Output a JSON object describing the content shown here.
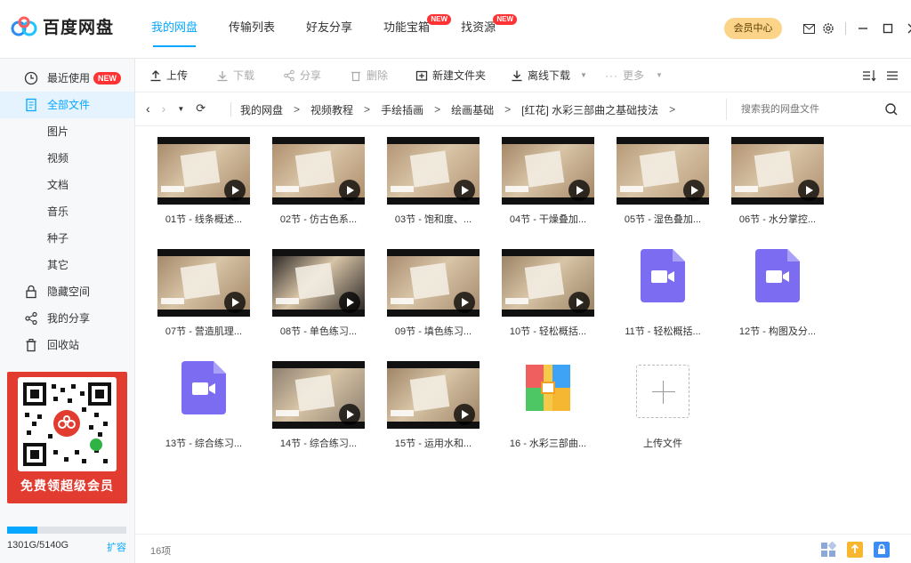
{
  "app": {
    "name": "百度网盘"
  },
  "nav": {
    "tabs": [
      {
        "label": "我的网盘",
        "active": true,
        "badge": ""
      },
      {
        "label": "传输列表",
        "active": false,
        "badge": ""
      },
      {
        "label": "好友分享",
        "active": false,
        "badge": ""
      },
      {
        "label": "功能宝箱",
        "active": false,
        "badge": "NEW"
      },
      {
        "label": "找资源",
        "active": false,
        "badge": "NEW"
      }
    ],
    "vip_label": "会员中心"
  },
  "sidebar": {
    "items": [
      {
        "label": "最近使用",
        "icon": "clock-icon",
        "badge": "NEW"
      },
      {
        "label": "全部文件",
        "icon": "file-icon",
        "active": true
      },
      {
        "label": "图片"
      },
      {
        "label": "视频"
      },
      {
        "label": "文档"
      },
      {
        "label": "音乐"
      },
      {
        "label": "种子"
      },
      {
        "label": "其它"
      },
      {
        "label": "隐藏空间",
        "icon": "lock-icon"
      },
      {
        "label": "我的分享",
        "icon": "share-icon"
      },
      {
        "label": "回收站",
        "icon": "trash-icon"
      }
    ],
    "promo_text": "免费领超级会员",
    "quota": {
      "used_fraction": 0.253,
      "text": "1301G/5140G",
      "expand_label": "扩容"
    }
  },
  "toolbar": {
    "upload": "上传",
    "download": "下载",
    "share": "分享",
    "delete": "删除",
    "new_folder": "新建文件夹",
    "offline_download": "离线下载",
    "more": "更多"
  },
  "breadcrumb": {
    "items": [
      "我的网盘",
      "视频教程",
      "手绘插画",
      "绘画基础",
      "[红花] 水彩三部曲之基础技法"
    ],
    "search_placeholder": "搜索我的网盘文件"
  },
  "files": [
    {
      "name": "01节 - 线条概述...",
      "type": "video-thumb",
      "tone": "#a98c6c"
    },
    {
      "name": "02节 - 仿古色系...",
      "type": "video-thumb",
      "tone": "#b0906e"
    },
    {
      "name": "03节 - 饱和度、...",
      "type": "video-thumb",
      "tone": "#b49676"
    },
    {
      "name": "04节 - 干燥叠加...",
      "type": "video-thumb",
      "tone": "#a58868"
    },
    {
      "name": "05节 - 湿色叠加...",
      "type": "video-thumb",
      "tone": "#b69a78"
    },
    {
      "name": "06节 - 水分掌控...",
      "type": "video-thumb",
      "tone": "#b39474"
    },
    {
      "name": "07节 - 营造肌理...",
      "type": "video-thumb",
      "tone": "#a4896a"
    },
    {
      "name": "08节 - 单色练习...",
      "type": "video-thumb",
      "tone": "#2e2a28"
    },
    {
      "name": "09节 - 填色练习...",
      "type": "video-thumb",
      "tone": "#a88c70"
    },
    {
      "name": "10节 - 轻松概括...",
      "type": "video-thumb",
      "tone": "#9c8466"
    },
    {
      "name": "11节 - 轻松概括...",
      "type": "video-icon"
    },
    {
      "name": "12节 - 构图及分...",
      "type": "video-icon"
    },
    {
      "name": "13节 - 综合练习...",
      "type": "video-icon"
    },
    {
      "name": "14节 - 综合练习...",
      "type": "video-thumb",
      "tone": "#8e8070"
    },
    {
      "name": "15节 - 运用水和...",
      "type": "video-thumb",
      "tone": "#9f8568"
    },
    {
      "name": "16 - 水彩三部曲...",
      "type": "zip"
    },
    {
      "name": "上传文件",
      "type": "upload"
    }
  ],
  "status": {
    "count": "16项"
  },
  "colors": {
    "accent": "#06a7ff",
    "video_icon": "#7b6cf2",
    "badge": "#ff3333"
  }
}
